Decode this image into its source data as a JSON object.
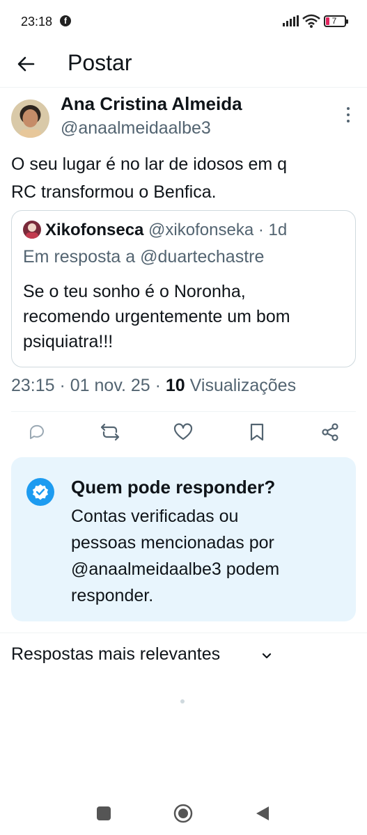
{
  "status_bar": {
    "time": "23:18",
    "battery": "7"
  },
  "header": {
    "title": "Postar"
  },
  "post": {
    "author_name": "Ana Cristina Almeida",
    "author_handle": "@anaalmeidaalbe3",
    "text_line1": "O seu lugar é no lar de idosos em q",
    "text_line2": "RC transformou o  Benfica.",
    "quote": {
      "author_name": "Xikofonseca",
      "author_meta": " @xikofonseka · 1d",
      "reply_to": "Em resposta a @duartechastre",
      "text_line1": "Se o teu sonho é o Noronha,",
      "text_line2": "recomendo urgentemente um bom",
      "text_line3": "psiquiatra!!!"
    },
    "time": "23:15 · 01 nov. 25 · ",
    "views_count": "10",
    "views_label": " Visualizações"
  },
  "actions": [
    "reply-icon",
    "repost-icon",
    "like-icon",
    "bookmark-icon",
    "share-icon"
  ],
  "reply_restriction": {
    "title": "Quem pode responder?",
    "line1": "Contas verificadas ou",
    "line2": "pessoas mencionadas por",
    "line3": "@anaalmeidaalbe3 podem",
    "line4": "responder."
  },
  "replies": {
    "sort_label": "Respostas mais relevantes"
  },
  "colors": {
    "accent": "#1d9bf0",
    "muted": "#536471",
    "reply_box_bg": "#e8f5fd"
  }
}
